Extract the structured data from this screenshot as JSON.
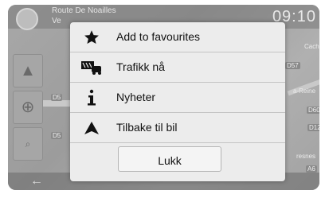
{
  "status_bar": {
    "street_line1": "Route De Noailles",
    "street_line2": "Ve",
    "clock": "09:10"
  },
  "map_labels": {
    "road_d57": "D57",
    "road_d60": "D60",
    "road_d12": "D12",
    "road_a6": "A6",
    "road_d5": "D5",
    "road_d5b": "D5",
    "place_cache": "Cache",
    "place_reine": "a-Reine",
    "place_fresnes": "resnes"
  },
  "menu": {
    "items": [
      {
        "label": "Add to favourites",
        "icon": "star-icon"
      },
      {
        "label": "Trafikk nå",
        "icon": "traffic-icon"
      },
      {
        "label": "Nyheter",
        "icon": "info-icon"
      },
      {
        "label": "Tilbake til bil",
        "icon": "navigation-arrow-icon"
      }
    ],
    "close_label": "Lukk"
  }
}
